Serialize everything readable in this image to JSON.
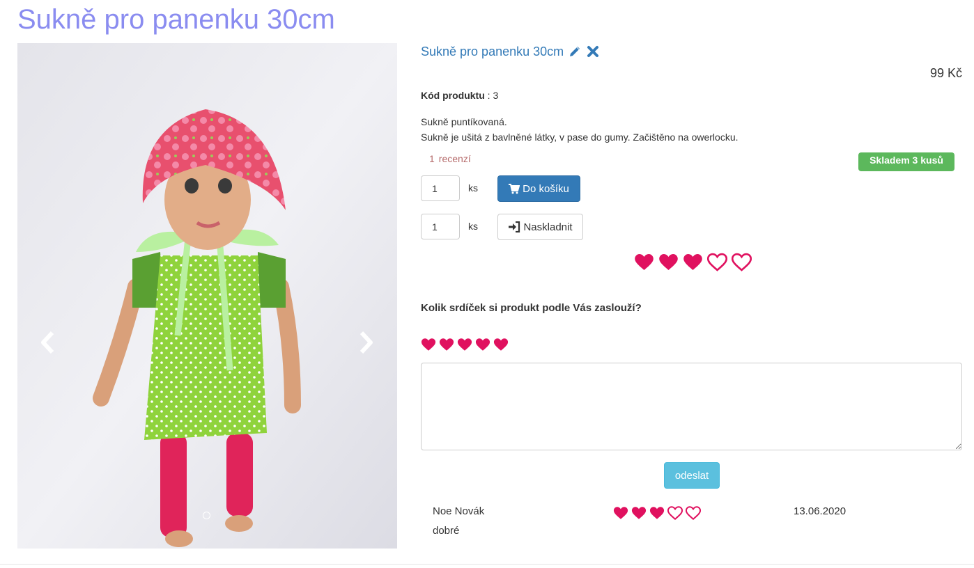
{
  "page": {
    "title": "Sukně pro panenku 30cm"
  },
  "product": {
    "name": "Sukně pro panenku 30cm",
    "price": "99 Kč",
    "code_label": "Kód produktu",
    "code_sep": " : ",
    "code_value": "3",
    "description_line1": "Sukně puntíkovaná.",
    "description_line2": "Sukně je ušitá z bavlněné látky, v pase do gumy. Začištěno na owerlocku.",
    "reviews_count": "1",
    "reviews_label": "recenzí",
    "stock_badge": "Skladem 3 kusů",
    "rating_filled": 3,
    "rating_max": 5
  },
  "cart": {
    "quantity": "1",
    "unit": "ks",
    "add_label": "Do košíku",
    "icon": "shopping-cart-icon"
  },
  "restock": {
    "quantity": "1",
    "unit": "ks",
    "label": "Naskladnit",
    "icon": "log-in-icon"
  },
  "review_form": {
    "question": "Kolik srdíček si produkt podle Vás zaslouží?",
    "hearts": 5,
    "text": "",
    "submit_label": "odeslat"
  },
  "reviews": [
    {
      "author": "Noe Novák",
      "text": "dobré",
      "rating": 3,
      "max": 5,
      "date": "13.06.2020"
    }
  ],
  "colors": {
    "title": "#8a8cf0",
    "link": "#337ab7",
    "heart": "#e0115f",
    "badge_success": "#5cb85c",
    "btn_primary": "#337ab7",
    "btn_info": "#5bc0de"
  }
}
